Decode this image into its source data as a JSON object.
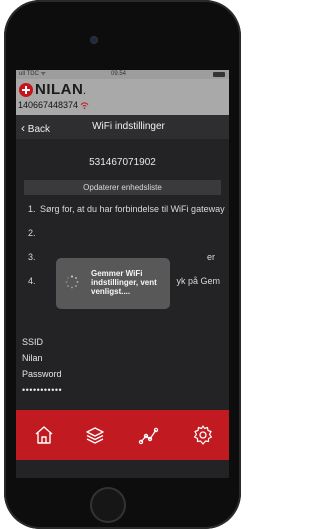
{
  "status_bar": {
    "carrier": "ull TDC ᯤ",
    "time": "09.54"
  },
  "brand": {
    "logo_text": "NILAN",
    "logo_suffix": ".",
    "device_id": "140667448374",
    "wifi_icon": "wifi-icon"
  },
  "nav": {
    "back_label": "Back",
    "title": "WiFi indstillinger"
  },
  "serial_number": "531467071902",
  "update_status": "Opdaterer enhedsliste",
  "steps": [
    {
      "num": "1.",
      "text": "Sørg for, at du har forbindelse til WiFi gateway"
    },
    {
      "num": "2.",
      "text": ""
    },
    {
      "num": "3.",
      "text": "er"
    },
    {
      "num": "4.",
      "text": "yk på Gem"
    }
  ],
  "ssid": {
    "label": "SSID",
    "value": "Nilan"
  },
  "password": {
    "label": "Password",
    "value": "•••••••••••"
  },
  "modal": {
    "message": "Gemmer WiFi indstillinger, vent venligst...."
  },
  "tabs": [
    "home-icon",
    "layers-icon",
    "graph-icon",
    "settings-icon"
  ],
  "colors": {
    "accent": "#c11a20",
    "background": "#232325"
  }
}
